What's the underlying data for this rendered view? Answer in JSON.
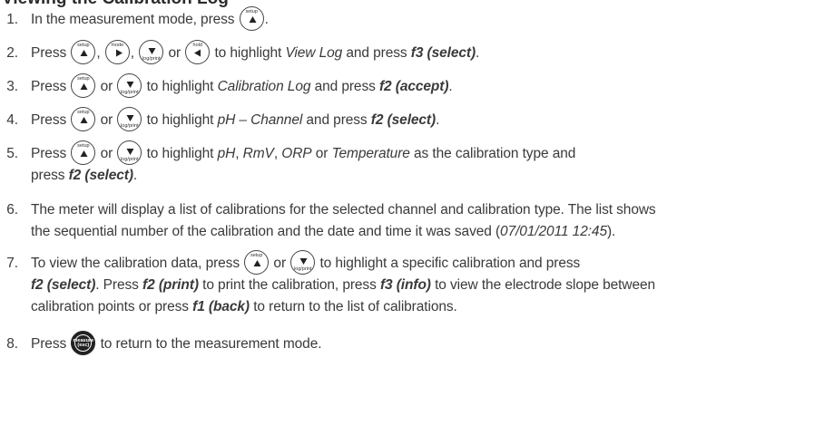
{
  "heading": "Viewing the Calibration Log",
  "buttons": {
    "setup_top": "setup",
    "mode_top": "mode",
    "logprint_bot": "log/print",
    "hold_top": "hold",
    "measure_top": "measure",
    "measure_bot": "(esc)"
  },
  "steps": [
    {
      "num": "1.",
      "t1": "In the measurement mode, press",
      "t2": "."
    },
    {
      "num": "2.",
      "t1": "Press",
      "sep1": ",",
      "sep2": ",",
      "or": "or",
      "t2": "to highlight",
      "em1": "View Log",
      "t3": "and press",
      "key1": "f3 (select)",
      "end": "."
    },
    {
      "num": "3.",
      "t1": "Press",
      "or": "or",
      "t2": "to highlight",
      "em1": "Calibration Log",
      "t3": "and press",
      "key1": "f2 (accept)",
      "end": "."
    },
    {
      "num": "4.",
      "t1": "Press",
      "or": "or",
      "t2": "to highlight",
      "em1": "pH – Channel",
      "t3": "and press",
      "key1": "f2 (select)",
      "end": "."
    },
    {
      "num": "5.",
      "t1": "Press",
      "or": "or",
      "t2": "to highlight",
      "em1": "pH",
      "c1": ",",
      "em2": "RmV",
      "c2": ",",
      "em3": "ORP",
      "or2": "or",
      "em4": "Temperature",
      "t3": "as the calibration type and",
      "t4": "press",
      "key1": "f2 (select)",
      "end": "."
    },
    {
      "num": "6.",
      "line1": "The meter will display a list of calibrations for the selected channel and calibration type. The list shows",
      "line2": "the sequential number of the calibration and the date and time it was saved (",
      "em1": "07/01/2011 12:45",
      "end": ")."
    },
    {
      "num": "7.",
      "t1": "To view the calibration data, press",
      "or": "or",
      "t2": "to highlight a specific calibration and press",
      "key1": "f2 (select)",
      "t3": ". Press",
      "key2": "f2 (print)",
      "t4": "to print the calibration, press",
      "key3": "f3 (info)",
      "t5": "to view the electrode slope between",
      "t6": "calibration points or press",
      "key4": "f1 (back)",
      "t7": "to return to the list of calibrations."
    },
    {
      "num": "8.",
      "t1": "Press",
      "t2": "to return to the measurement mode."
    }
  ]
}
